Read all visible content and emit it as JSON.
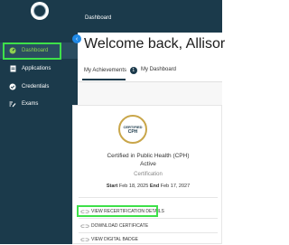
{
  "sidebar": {
    "items": [
      {
        "label": "Dashboard",
        "icon": "gauge-icon"
      },
      {
        "label": "Applications",
        "icon": "document-icon"
      },
      {
        "label": "Credentials",
        "icon": "check-circle-icon"
      },
      {
        "label": "Exams",
        "icon": "pencil-list-icon"
      }
    ],
    "active_color": "#8fd14f"
  },
  "topbar": {
    "breadcrumb": "Dashboard"
  },
  "welcome": "Welcome back, Allisor",
  "tabs": [
    {
      "label": "My Achievements",
      "badge": "1"
    },
    {
      "label": "My Dashboard"
    }
  ],
  "card": {
    "seal_top": "CERTIFIED",
    "seal_main": "CPH",
    "title": "Certified in Public Health (CPH)",
    "status": "Active",
    "type": "Certification",
    "start_label": "Start",
    "start_date": "Feb 18, 2025",
    "end_label": "End",
    "end_date": "Feb 17, 2027",
    "actions": [
      {
        "label": "VIEW RECERTIFICATION DETAILS",
        "icon": "link-icon"
      },
      {
        "label": "DOWNLOAD CERTIFICATE",
        "icon": "link-icon"
      },
      {
        "label": "VIEW DIGITAL BADGE",
        "icon": "link-icon"
      }
    ]
  },
  "colors": {
    "sidebar": "#1b3a4b",
    "highlight": "#3ee04a",
    "seal": "#c9a64a"
  }
}
